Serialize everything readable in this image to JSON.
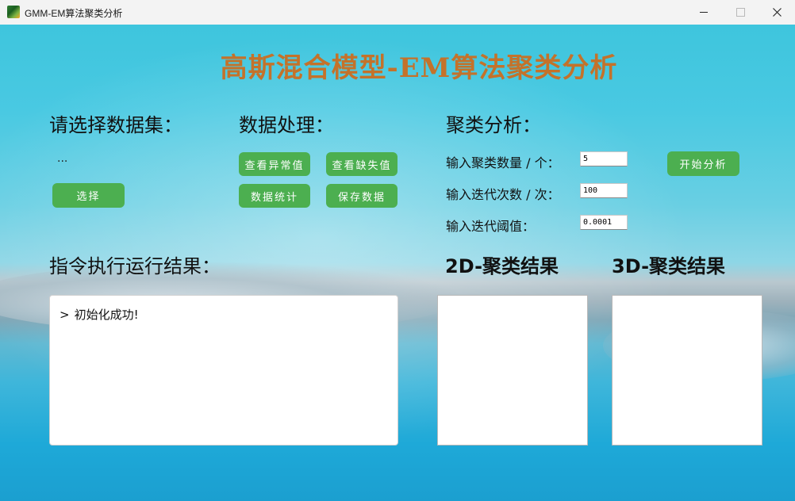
{
  "window": {
    "title": "GMM-EM算法聚类分析",
    "controls": [
      "minimize",
      "maximize",
      "close"
    ]
  },
  "main": {
    "title": "高斯混合模型-EM算法聚类分析"
  },
  "dataset": {
    "label": "请选择数据集：",
    "path": "...",
    "select_button": "选择"
  },
  "processing": {
    "label": "数据处理：",
    "buttons": {
      "view_outliers": "查看异常值",
      "view_missing": "查看缺失值",
      "data_stats": "数据统计",
      "save_data": "保存数据"
    }
  },
  "clustering": {
    "label": "聚类分析：",
    "cluster_count_label": "输入聚类数量 / 个：",
    "cluster_count_value": "5",
    "iterations_label": "输入迭代次数 / 次：",
    "iterations_value": "100",
    "threshold_label": "输入迭代阈值：",
    "threshold_value": "0.0001",
    "start_button": "开始分析"
  },
  "log": {
    "label": "指令执行运行结果：",
    "prompt": ">",
    "lines": [
      "初始化成功!"
    ]
  },
  "results": {
    "label_2d": "2D-聚类结果",
    "label_3d": "3D-聚类结果"
  },
  "colors": {
    "accent_button": "#4caf50",
    "title": "#c4722a"
  }
}
